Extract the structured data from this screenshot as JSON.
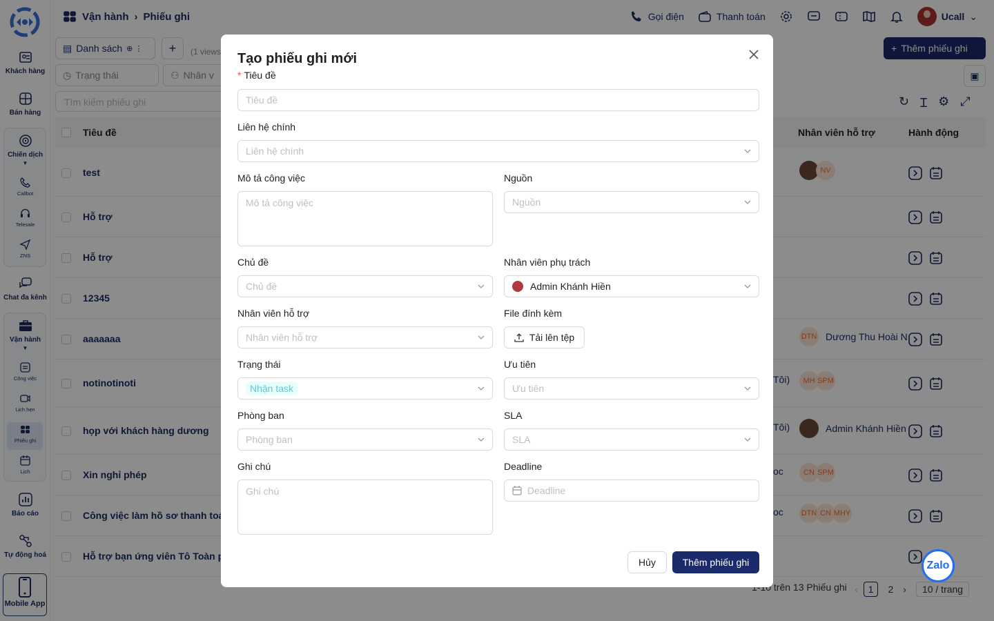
{
  "sidebar": {
    "items": [
      {
        "label": "Khách hàng",
        "icon": "customer-icon"
      },
      {
        "label": "Bán hàng",
        "icon": "sales-icon"
      },
      {
        "label": "Chiến dịch",
        "icon": "campaign-icon"
      },
      {
        "label": "Callbot",
        "icon": "phone-icon"
      },
      {
        "label": "Telesale",
        "icon": "headset-icon"
      },
      {
        "label": "ZNS",
        "icon": "send-icon"
      },
      {
        "label": "Chat đa kênh",
        "icon": "chat-icon"
      },
      {
        "label": "Vận hành",
        "icon": "briefcase-icon"
      },
      {
        "label": "Công việc",
        "icon": "task-icon"
      },
      {
        "label": "Lịch hẹn",
        "icon": "video-icon"
      },
      {
        "label": "Phiếu ghi",
        "icon": "ticket-icon"
      },
      {
        "label": "Lịch",
        "icon": "calendar-icon"
      },
      {
        "label": "Báo cáo",
        "icon": "report-icon"
      },
      {
        "label": "Tự động hoá",
        "icon": "automation-icon"
      },
      {
        "label": "Mobile App",
        "icon": "mobile-icon"
      }
    ]
  },
  "header": {
    "breadcrumb": [
      "Vận hành",
      "Phiếu ghi"
    ],
    "call_label": "Gọi điện",
    "payment_label": "Thanh toán",
    "user_name": "Ucall"
  },
  "toolbar": {
    "view_label": "Danh sách",
    "views_count": "(1 views",
    "add_button": "Thêm phiếu ghi",
    "filter_status": "Trạng thái",
    "filter_staff": "Nhân v",
    "search_placeholder": "Tìm kiếm phiếu ghi"
  },
  "table": {
    "headers": {
      "title": "Tiêu đề",
      "support": "Nhân viên hỗ trợ",
      "actions": "Hành động"
    },
    "rows": [
      {
        "title": "test",
        "staff": [
          "",
          "NV"
        ],
        "staff_name": "",
        "partial": ""
      },
      {
        "title": "Hỗ trợ",
        "staff": [],
        "staff_name": "",
        "partial": ""
      },
      {
        "title": "Hỗ trợ",
        "staff": [],
        "staff_name": "",
        "partial": ""
      },
      {
        "title": "12345",
        "staff": [],
        "staff_name": "",
        "partial": ""
      },
      {
        "title": "aaaaaaa",
        "staff": [
          "DTN"
        ],
        "staff_name": "Dương Thu Hoài N",
        "partial": ""
      },
      {
        "title": "notinotinoti",
        "staff": [
          "MH",
          "SPM"
        ],
        "staff_name": "",
        "partial": "Tôi)"
      },
      {
        "title": "họp với khách hàng dương",
        "staff": [
          ""
        ],
        "staff_name": "Admin Khánh Hiền",
        "partial": "Tôi)"
      },
      {
        "title": "Xin nghỉ phép",
        "staff": [
          "CN",
          "SPM"
        ],
        "staff_name": "",
        "partial": "oc"
      },
      {
        "title": "Công việc làm hồ sơ thanh toán",
        "staff": [
          "DTN",
          "CN",
          "MHY"
        ],
        "staff_name": "",
        "partial": "oc"
      },
      {
        "title": "Hỗ trợ bạn ứng viên Tô Toàn phó",
        "staff": [],
        "staff_name": "",
        "partial": ""
      }
    ]
  },
  "pagination": {
    "summary": "1-10 trên 13 Phiếu ghi",
    "pages": [
      "1",
      "2"
    ],
    "page_size": "10 / trang"
  },
  "modal": {
    "title": "Tạo phiếu ghi mới",
    "fields": {
      "title": {
        "label": "Tiêu đề",
        "placeholder": "Tiêu đề",
        "required": true
      },
      "contact": {
        "label": "Liên hệ chính",
        "placeholder": "Liên hệ chính"
      },
      "description": {
        "label": "Mô tả công việc",
        "placeholder": "Mô tả công việc"
      },
      "source": {
        "label": "Nguồn",
        "placeholder": "Nguồn"
      },
      "topic": {
        "label": "Chủ đề",
        "placeholder": "Chủ đề"
      },
      "owner": {
        "label": "Nhân viên phụ trách",
        "value": "Admin Khánh Hiền"
      },
      "support": {
        "label": "Nhân viên hỗ trợ",
        "placeholder": "Nhân viên hỗ trợ"
      },
      "attachment": {
        "label": "File đính kèm",
        "button": "Tải lên tệp"
      },
      "status": {
        "label": "Trạng thái",
        "value": "Nhận task"
      },
      "priority": {
        "label": "Ưu tiên",
        "placeholder": "Ưu tiên"
      },
      "department": {
        "label": "Phòng ban",
        "placeholder": "Phòng ban"
      },
      "sla": {
        "label": "SLA",
        "placeholder": "SLA"
      },
      "note": {
        "label": "Ghi chú",
        "placeholder": "Ghi chú"
      },
      "deadline": {
        "label": "Deadline",
        "placeholder": "Deadline"
      }
    },
    "cancel_label": "Hủy",
    "submit_label": "Thêm phiếu ghi"
  },
  "zalo_label": "Zalo",
  "colors": {
    "primary": "#1b2a6b",
    "accent": "#1e6ff2",
    "required": "#ff4d4f"
  }
}
